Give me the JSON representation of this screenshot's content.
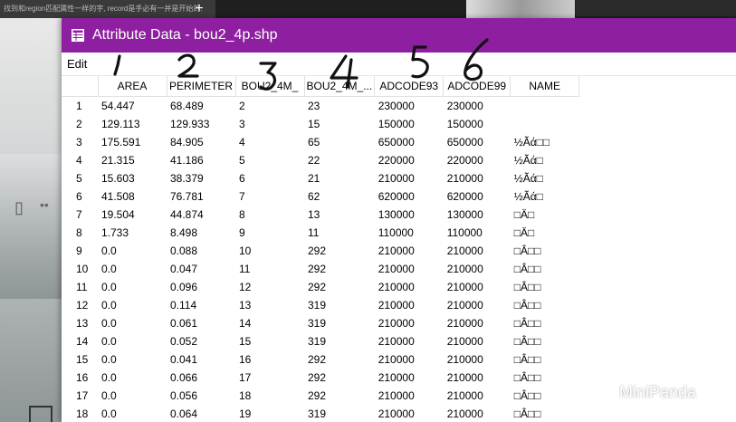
{
  "background": {
    "tab_text": "找到和region匹配属性一样的字, record是手必有一并是开始的.",
    "new_tab_symbol": "+"
  },
  "window": {
    "title": "Attribute Data - bou2_4p.shp",
    "menu": {
      "edit_label": "Edit"
    },
    "accent_color": "#8f1fa1"
  },
  "table": {
    "columns": [
      "",
      "AREA",
      "PERIMETER",
      "BOU2_4M_",
      "BOU2_4M_...",
      "ADCODE93",
      "ADCODE99",
      "NAME"
    ],
    "rows": [
      [
        "1",
        "54.447",
        "68.489",
        "2",
        "23",
        "230000",
        "230000",
        ""
      ],
      [
        "2",
        "129.113",
        "129.933",
        "3",
        "15",
        "150000",
        "150000",
        ""
      ],
      [
        "3",
        "175.591",
        "84.905",
        "4",
        "65",
        "650000",
        "650000",
        "½Ãά□□"
      ],
      [
        "4",
        "21.315",
        "41.186",
        "5",
        "22",
        "220000",
        "220000",
        "½Ãά□"
      ],
      [
        "5",
        "15.603",
        "38.379",
        "6",
        "21",
        "210000",
        "210000",
        "½Ãά□"
      ],
      [
        "6",
        "41.508",
        "76.781",
        "7",
        "62",
        "620000",
        "620000",
        "½Ãά□"
      ],
      [
        "7",
        "19.504",
        "44.874",
        "8",
        "13",
        "130000",
        "130000",
        "□Ä□"
      ],
      [
        "8",
        "1.733",
        "8.498",
        "9",
        "11",
        "110000",
        "110000",
        "□Ä□"
      ],
      [
        "9",
        "0.0",
        "0.088",
        "10",
        "292",
        "210000",
        "210000",
        "□Â□□"
      ],
      [
        "10",
        "0.0",
        "0.047",
        "11",
        "292",
        "210000",
        "210000",
        "□Â□□"
      ],
      [
        "11",
        "0.0",
        "0.096",
        "12",
        "292",
        "210000",
        "210000",
        "□Â□□"
      ],
      [
        "12",
        "0.0",
        "0.114",
        "13",
        "319",
        "210000",
        "210000",
        "□Â□□"
      ],
      [
        "13",
        "0.0",
        "0.061",
        "14",
        "319",
        "210000",
        "210000",
        "□Â□□"
      ],
      [
        "14",
        "0.0",
        "0.052",
        "15",
        "319",
        "210000",
        "210000",
        "□Â□□"
      ],
      [
        "15",
        "0.0",
        "0.041",
        "16",
        "292",
        "210000",
        "210000",
        "□Â□□"
      ],
      [
        "16",
        "0.0",
        "0.066",
        "17",
        "292",
        "210000",
        "210000",
        "□Â□□"
      ],
      [
        "17",
        "0.0",
        "0.056",
        "18",
        "292",
        "210000",
        "210000",
        "□Â□□"
      ],
      [
        "18",
        "0.0",
        "0.064",
        "19",
        "319",
        "210000",
        "210000",
        "□Â□□"
      ]
    ]
  },
  "annotations": [
    "1",
    "2",
    "3",
    "4",
    "5",
    "6"
  ],
  "watermark": {
    "text": "MiniPanda",
    "icon": "wechat-icon"
  }
}
